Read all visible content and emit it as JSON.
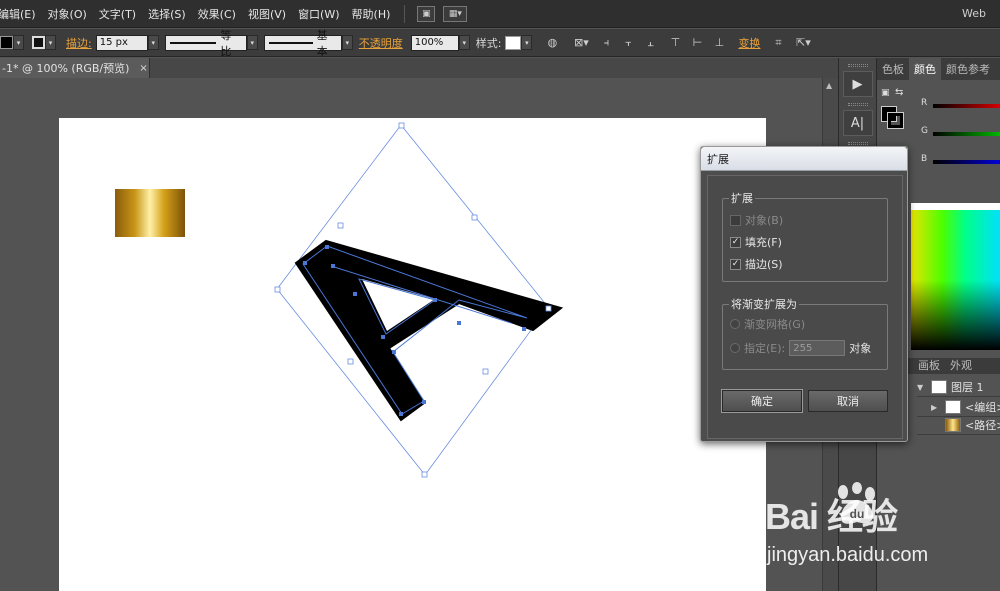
{
  "menubar": {
    "items": [
      "编辑(E)",
      "对象(O)",
      "文字(T)",
      "选择(S)",
      "效果(C)",
      "视图(V)",
      "窗口(W)",
      "帮助(H)"
    ],
    "workspace": "Web"
  },
  "controlbar": {
    "stroke_label": "描边:",
    "stroke_weight": "15 px",
    "stroke_profile": "等比",
    "brush_def": "基本",
    "opacity_label": "不透明度",
    "opacity_value": "100%",
    "style_label": "样式:",
    "transform_label": "变换"
  },
  "document": {
    "tab_title": "-1* @ 100% (RGB/预览)",
    "tab_close": "×"
  },
  "color_panel": {
    "tabs": [
      "色板",
      "颜色",
      "颜色参考"
    ],
    "active_tab": "颜色",
    "channels": [
      "R",
      "G",
      "B"
    ]
  },
  "layers_panel": {
    "tabs": [
      "画板",
      "外观"
    ],
    "rows": [
      {
        "label": "图层 1"
      },
      {
        "label": "<编组>"
      },
      {
        "label": "<路径>"
      }
    ]
  },
  "dialog": {
    "title": "扩展",
    "expand_group": "扩展",
    "opt_object": "对象(B)",
    "opt_fill": "填充(F)",
    "opt_stroke": "描边(S)",
    "gradient_group": "将渐变扩展为",
    "opt_gradient_mesh": "渐变网格(G)",
    "opt_specify": "指定(E):",
    "specify_value": "255",
    "specify_unit": "对象",
    "ok_label": "确定",
    "cancel_label": "取消",
    "checks": {
      "object": false,
      "fill": true,
      "stroke": true
    }
  },
  "watermark": {
    "brand": "Bai  经验",
    "url": "jingyan.baidu.com"
  },
  "colors": {
    "accent_orange": "#e8a13b",
    "selection_blue": "#4a76d4",
    "gold_dark": "#8a5d0c",
    "gold_light": "#fff1a8"
  }
}
